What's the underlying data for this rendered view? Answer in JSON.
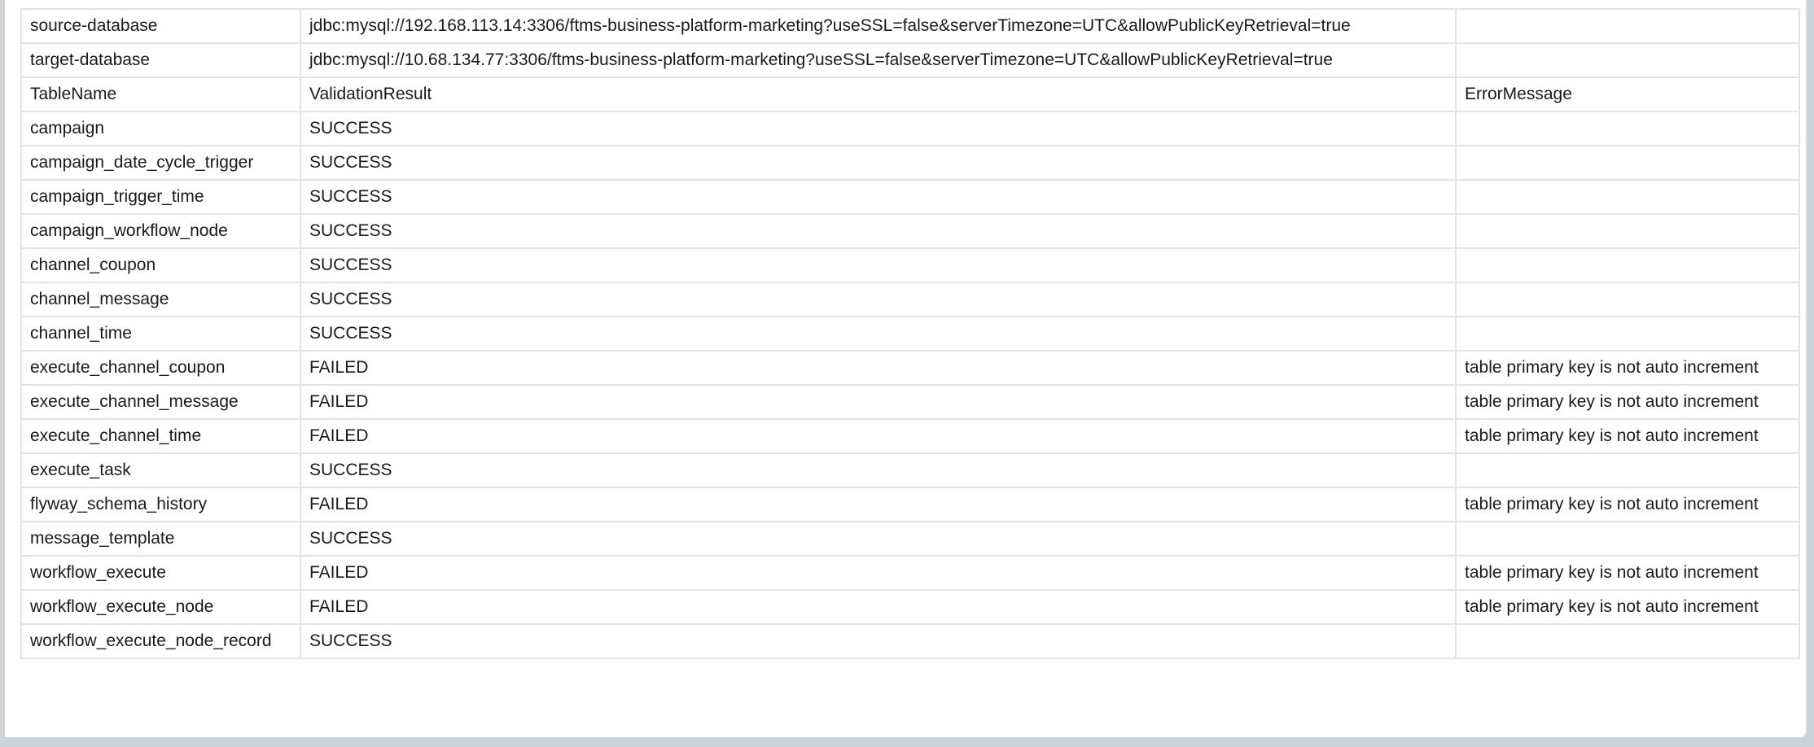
{
  "header_rows": [
    {
      "label": "source-database",
      "value": "jdbc:mysql://192.168.113.14:3306/ftms-business-platform-marketing?useSSL=false&serverTimezone=UTC&allowPublicKeyRetrieval=true",
      "extra": ""
    },
    {
      "label": "target-database",
      "value": "jdbc:mysql://10.68.134.77:3306/ftms-business-platform-marketing?useSSL=false&serverTimezone=UTC&allowPublicKeyRetrieval=true",
      "extra": ""
    }
  ],
  "columns": [
    "TableName",
    "ValidationResult",
    "ErrorMessage"
  ],
  "rows": [
    {
      "table": "campaign",
      "result": "SUCCESS",
      "error": ""
    },
    {
      "table": "campaign_date_cycle_trigger",
      "result": "SUCCESS",
      "error": ""
    },
    {
      "table": "campaign_trigger_time",
      "result": "SUCCESS",
      "error": ""
    },
    {
      "table": "campaign_workflow_node",
      "result": "SUCCESS",
      "error": ""
    },
    {
      "table": "channel_coupon",
      "result": "SUCCESS",
      "error": ""
    },
    {
      "table": "channel_message",
      "result": "SUCCESS",
      "error": ""
    },
    {
      "table": "channel_time",
      "result": "SUCCESS",
      "error": ""
    },
    {
      "table": "execute_channel_coupon",
      "result": "FAILED",
      "error": "table primary key is not auto increment"
    },
    {
      "table": "execute_channel_message",
      "result": "FAILED",
      "error": "table primary key is not auto increment"
    },
    {
      "table": "execute_channel_time",
      "result": "FAILED",
      "error": "table primary key is not auto increment"
    },
    {
      "table": "execute_task",
      "result": "SUCCESS",
      "error": ""
    },
    {
      "table": "flyway_schema_history",
      "result": "FAILED",
      "error": "table primary key is not auto increment"
    },
    {
      "table": "message_template",
      "result": "SUCCESS",
      "error": ""
    },
    {
      "table": "workflow_execute",
      "result": "FAILED",
      "error": "table primary key is not auto increment"
    },
    {
      "table": "workflow_execute_node",
      "result": "FAILED",
      "error": "table primary key is not auto increment"
    },
    {
      "table": "workflow_execute_node_record",
      "result": "SUCCESS",
      "error": ""
    }
  ]
}
